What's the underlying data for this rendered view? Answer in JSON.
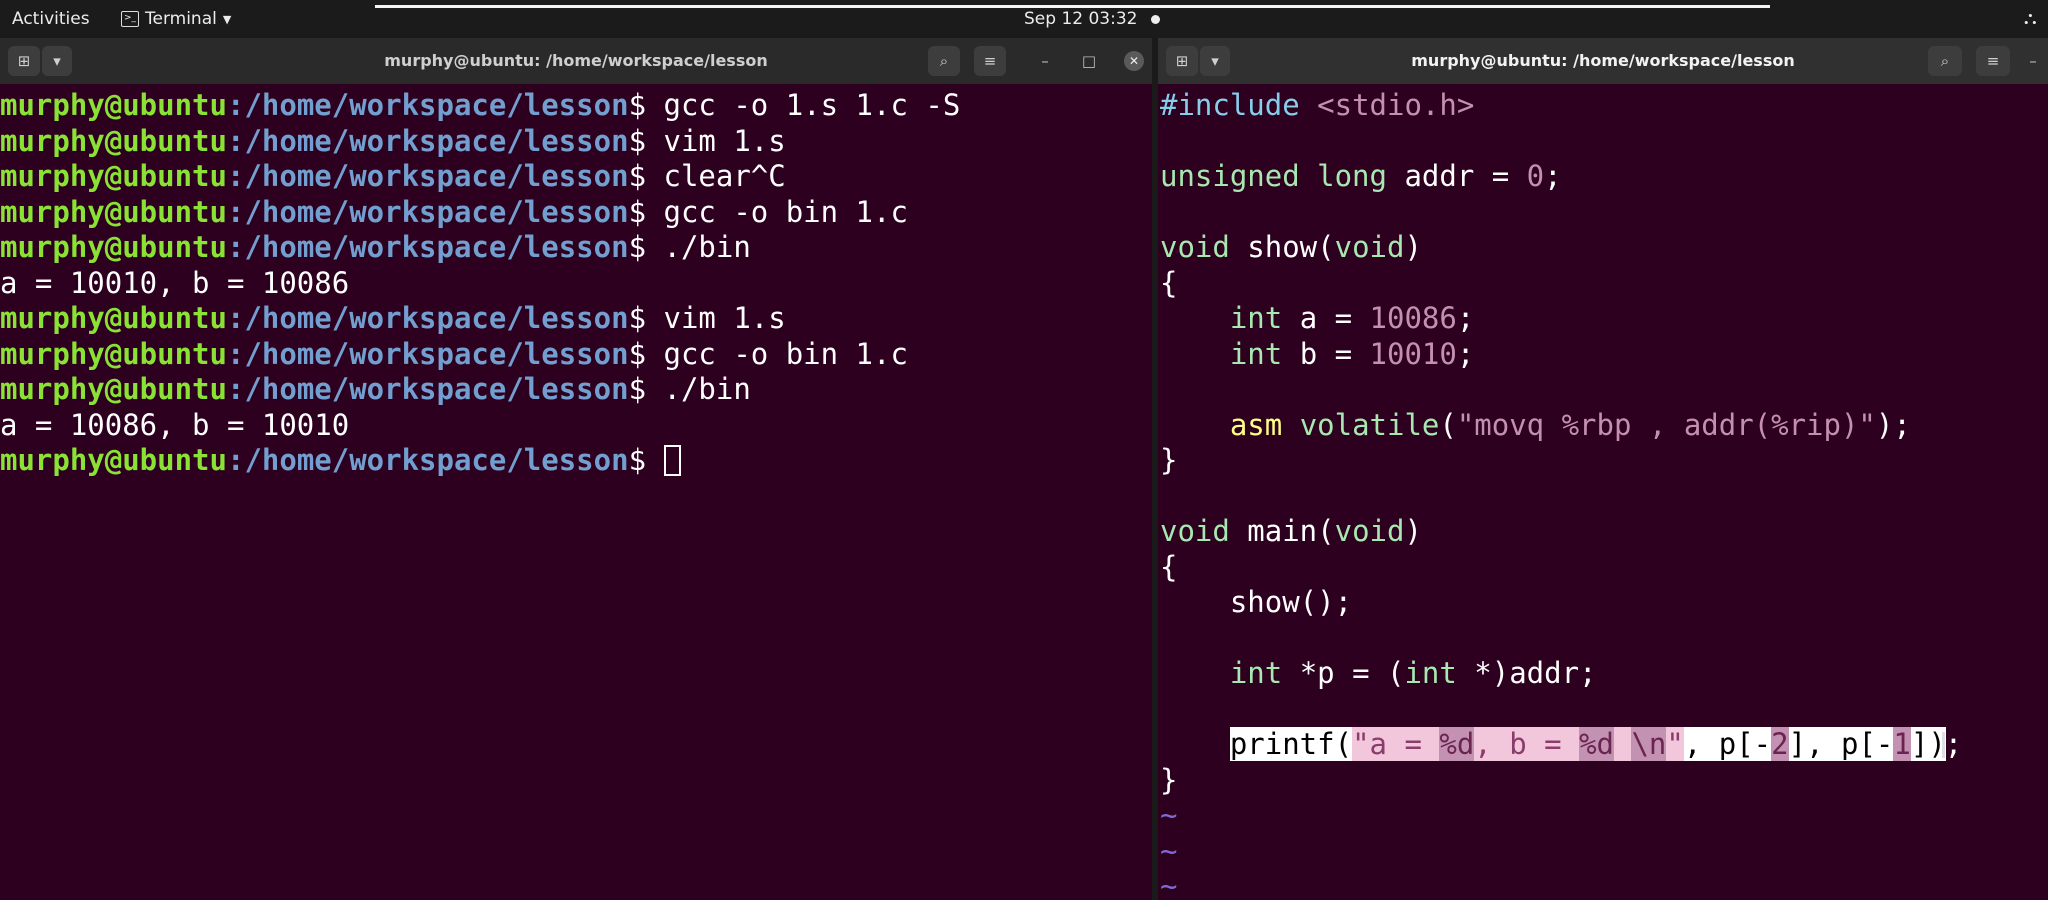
{
  "topbar": {
    "activities": "Activities",
    "app_name": "Terminal",
    "clock": "Sep 12  03:32"
  },
  "left_window": {
    "title": "murphy@ubuntu: /home/workspace/lesson",
    "user": "murphy@ubuntu",
    "path": ":/home/workspace/lesson",
    "lines": [
      {
        "type": "prompt",
        "cmd": " gcc -o 1.s 1.c -S"
      },
      {
        "type": "prompt",
        "cmd": " vim 1.s"
      },
      {
        "type": "prompt",
        "cmd": " clear^C"
      },
      {
        "type": "prompt",
        "cmd": " gcc -o bin 1.c"
      },
      {
        "type": "prompt",
        "cmd": " ./bin"
      },
      {
        "type": "out",
        "text": "a = 10010, b = 10086"
      },
      {
        "type": "prompt",
        "cmd": " vim 1.s"
      },
      {
        "type": "prompt",
        "cmd": " gcc -o bin 1.c"
      },
      {
        "type": "prompt",
        "cmd": " ./bin"
      },
      {
        "type": "out",
        "text": "a = 10086, b = 10010"
      },
      {
        "type": "prompt",
        "cmd": " ",
        "cursor": true
      }
    ]
  },
  "right_window": {
    "title": "murphy@ubuntu: /home/workspace/lesson",
    "code": {
      "l1_inc": "#include",
      "l1_hdr": " <stdio.h>",
      "l3_type": "unsigned long",
      "l3_rest": " addr = ",
      "l3_num": "0",
      "l3_end": ";",
      "l5_type": "void",
      "l5_mid": " show(",
      "l5_arg": "void",
      "l5_end": ")",
      "l6": "{",
      "l7_type": "int",
      "l7_rest": " a = ",
      "l7_num": "10086",
      "l7_end": ";",
      "l8_type": "int",
      "l8_rest": " b = ",
      "l8_num": "10010",
      "l8_end": ";",
      "l10_asm": "asm",
      "l10_vol": " volatile",
      "l10_open": "(",
      "l10_str": "\"movq %rbp , addr(%rip)\"",
      "l10_end": ");",
      "l11": "}",
      "l13_type": "void",
      "l13_mid": " main(",
      "l13_arg": "void",
      "l13_end": ")",
      "l14": "{",
      "l15": "show();",
      "l17_type": "int",
      "l17_mid": " *p = (",
      "l17_type2": "int",
      "l17_end": " *)addr;",
      "l19_a": "printf(",
      "l19_b": "\"a = ",
      "l19_c": "%d",
      "l19_d": ", b = ",
      "l19_e": "%d",
      "l19_f": " ",
      "l19_g": "\\n",
      "l19_h": "\"",
      "l19_i": ", p[-",
      "l19_j": "2",
      "l19_k": "], p[-",
      "l19_l": "1",
      "l19_m": "])",
      "l19_n": ";",
      "l20": "}",
      "tilde": "~"
    }
  }
}
